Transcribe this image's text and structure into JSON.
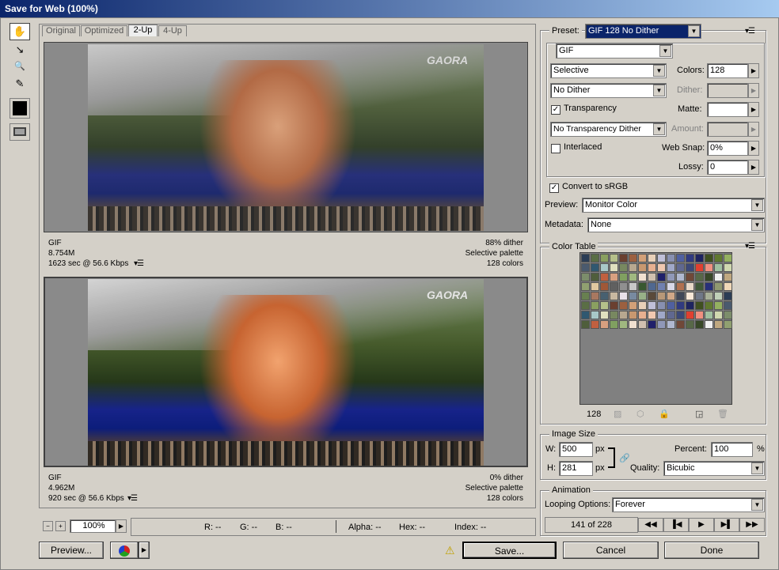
{
  "window": {
    "title": "Save for Web (100%)"
  },
  "tools": [
    {
      "name": "hand-tool-icon",
      "glyph": "✋"
    },
    {
      "name": "slice-select-tool-icon",
      "glyph": "↘"
    },
    {
      "name": "zoom-tool-icon",
      "glyph": "🔍"
    },
    {
      "name": "eyedropper-tool-icon",
      "glyph": "✎"
    }
  ],
  "tabs": [
    "Original",
    "Optimized",
    "2-Up",
    "4-Up"
  ],
  "active_tab": "2-Up",
  "panes": [
    {
      "logo": "GAORA",
      "format": "GIF",
      "size": "8.754M",
      "time": "1623 sec @ 56.6 Kbps",
      "dither": "88% dither",
      "palette": "Selective palette",
      "colors": "128 colors"
    },
    {
      "logo": "GAORA",
      "format": "GIF",
      "size": "4.962M",
      "time": "920 sec @ 56.6 Kbps",
      "dither": "0% dither",
      "palette": "Selective palette",
      "colors": "128 colors"
    }
  ],
  "statusbar": {
    "zoom": "100%",
    "r": "R: --",
    "g": "G: --",
    "b": "B: --",
    "alpha": "Alpha: --",
    "hex": "Hex: --",
    "index": "Index: --"
  },
  "preset": {
    "label": "Preset:",
    "value": "GIF 128 No Dither"
  },
  "settings": {
    "format": "GIF",
    "reduction": "Selective",
    "dither_algo": "No Dither",
    "transparency_label": "Transparency",
    "transparency_checked": true,
    "transparency_dither": "No Transparency Dither",
    "interlaced_label": "Interlaced",
    "interlaced_checked": false,
    "colors_label": "Colors:",
    "colors_value": "128",
    "dither_label": "Dither:",
    "dither_value": "",
    "matte_label": "Matte:",
    "matte_value": "",
    "amount_label": "Amount:",
    "amount_value": "",
    "websnap_label": "Web Snap:",
    "websnap_value": "0%",
    "lossy_label": "Lossy:",
    "lossy_value": "0"
  },
  "convert": {
    "label": "Convert to sRGB",
    "checked": true
  },
  "preview": {
    "label": "Preview:",
    "value": "Monitor Color"
  },
  "metadata": {
    "label": "Metadata:",
    "value": "None"
  },
  "color_table": {
    "title": "Color Table",
    "count": "128",
    "colors": [
      "#2b3d55",
      "#5a6e45",
      "#8aa060",
      "#b5c08a",
      "#6a4030",
      "#9c6040",
      "#d2a078",
      "#e8d0b8",
      "#c0c0d8",
      "#8890b0",
      "#5060a0",
      "#303a80",
      "#1e2460",
      "#405020",
      "#607830",
      "#94b060",
      "#4a5a6e",
      "#305870",
      "#a8c8c8",
      "#e0e0c0",
      "#788860",
      "#b8a890",
      "#c89870",
      "#e8b090",
      "#f0c8b0",
      "#a0a8c8",
      "#606890",
      "#3c4878",
      "#e04030",
      "#f09080",
      "#a0c0a0",
      "#d0d8b0",
      "#7c8d6b",
      "#4f5e3c",
      "#c06040",
      "#d8a080",
      "#80a060",
      "#a0b880",
      "#f0e0d0",
      "#d0c0b0",
      "#20206a",
      "#9098b8",
      "#b0b8d0",
      "#704838",
      "#586848",
      "#384828",
      "#f0f0f0",
      "#c0a880",
      "#90a070",
      "#e0c8a0",
      "#a05838",
      "#606060",
      "#909090",
      "#c8c8c8",
      "#385830",
      "#506890",
      "#7080b0",
      "#d8d8e8",
      "#b07050",
      "#e8d8c8",
      "#405838",
      "#28307a",
      "#909870",
      "#f0d8b8",
      "#688050",
      "#a87860",
      "#486070",
      "#c8b8a0",
      "#e8e0e8",
      "#788aa0",
      "#98b088",
      "#5a4a3a",
      "#b89878",
      "#d0a888",
      "#404858",
      "#f8e8d8",
      "#707888",
      "#a8b098",
      "#c0d0b8"
    ]
  },
  "image_size": {
    "title": "Image Size",
    "w_label": "W:",
    "w_value": "500",
    "h_label": "H:",
    "h_value": "281",
    "unit": "px",
    "percent_label": "Percent:",
    "percent_value": "100",
    "percent_unit": "%",
    "quality_label": "Quality:",
    "quality_value": "Bicubic"
  },
  "animation": {
    "title": "Animation",
    "looping_label": "Looping Options:",
    "looping_value": "Forever",
    "frame": "141 of 228"
  },
  "buttons": {
    "preview": "Preview...",
    "save": "Save...",
    "cancel": "Cancel",
    "done": "Done"
  }
}
